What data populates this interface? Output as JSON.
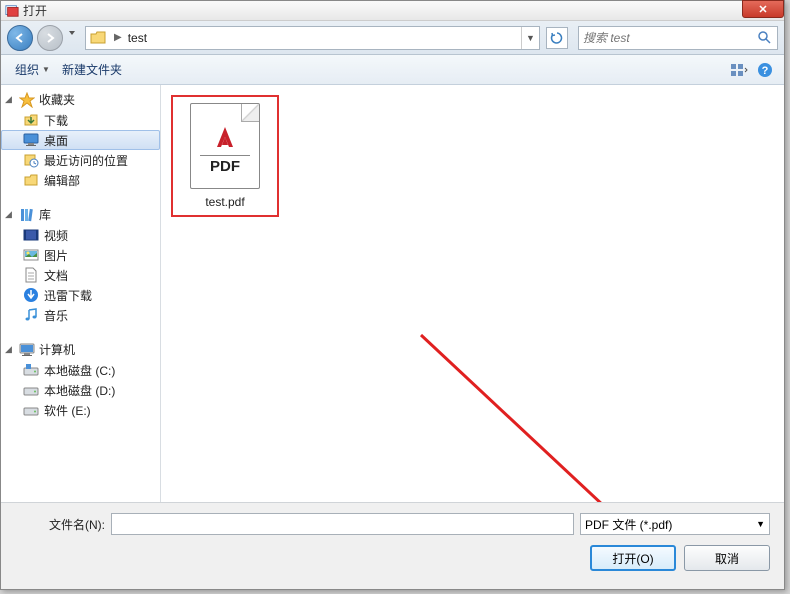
{
  "title": "打开",
  "nav": {
    "folder": "test",
    "search_placeholder": "搜索 test"
  },
  "toolbar": {
    "organize": "组织",
    "newfolder": "新建文件夹"
  },
  "sidebar": {
    "favorites": {
      "label": "收藏夹",
      "items": [
        {
          "label": "下载",
          "icon": "download"
        },
        {
          "label": "桌面",
          "icon": "desktop",
          "selected": true
        },
        {
          "label": "最近访问的位置",
          "icon": "recent"
        },
        {
          "label": "编辑部",
          "icon": "folder"
        }
      ]
    },
    "libraries": {
      "label": "库",
      "items": [
        {
          "label": "视频",
          "icon": "video"
        },
        {
          "label": "图片",
          "icon": "picture"
        },
        {
          "label": "文档",
          "icon": "document"
        },
        {
          "label": "迅雷下载",
          "icon": "xunlei"
        },
        {
          "label": "音乐",
          "icon": "music"
        }
      ]
    },
    "computer": {
      "label": "计算机",
      "items": [
        {
          "label": "本地磁盘 (C:)",
          "icon": "sysdrive"
        },
        {
          "label": "本地磁盘 (D:)",
          "icon": "drive"
        },
        {
          "label": "软件 (E:)",
          "icon": "drive"
        }
      ]
    }
  },
  "files": [
    {
      "name": "test.pdf",
      "type": "pdf"
    }
  ],
  "footer": {
    "filename_label": "文件名(N):",
    "filename_value": "",
    "filter": "PDF 文件 (*.pdf)",
    "open": "打开(O)",
    "cancel": "取消"
  }
}
